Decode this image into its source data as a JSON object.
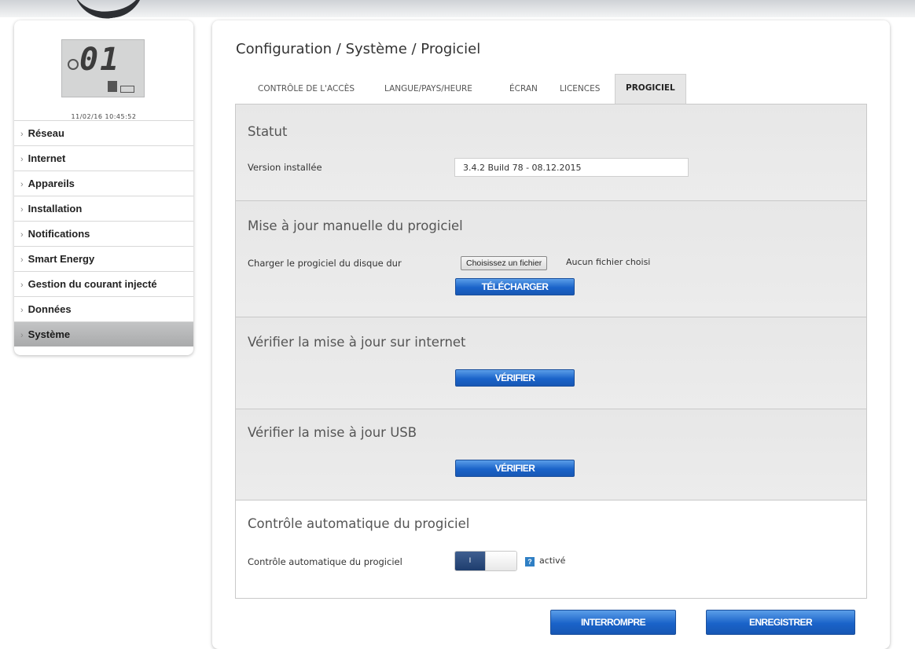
{
  "display": {
    "lcd_digits": "01",
    "datetime": "11/02/16 10:45:52"
  },
  "sidebar": {
    "items": [
      {
        "label": "Réseau"
      },
      {
        "label": "Internet"
      },
      {
        "label": "Appareils"
      },
      {
        "label": "Installation"
      },
      {
        "label": "Notifications"
      },
      {
        "label": "Smart Energy"
      },
      {
        "label": "Gestion du courant injecté"
      },
      {
        "label": "Données"
      },
      {
        "label": "Système",
        "active": true
      }
    ]
  },
  "header": {
    "breadcrumb": "Configuration / Système / Progiciel"
  },
  "tabs": [
    {
      "label": "CONTRÔLE DE L'ACCÈS"
    },
    {
      "label": "LANGUE/PAYS/HEURE"
    },
    {
      "label": "ÉCRAN"
    },
    {
      "label": "LICENCES"
    },
    {
      "label": "PROGICIEL",
      "active": true
    }
  ],
  "status": {
    "title": "Statut",
    "version_label": "Version installée",
    "version_value": "3.4.2 Build 78 - 08.12.2015"
  },
  "manual_update": {
    "title": "Mise à jour manuelle du progiciel",
    "load_label": "Charger le progiciel du disque dur",
    "file_button": "Choisissez un fichier",
    "file_status": "Aucun fichier choisi",
    "upload_button": "TÉLÉCHARGER"
  },
  "internet_check": {
    "title": "Vérifier la mise à jour sur internet",
    "button": "VÉRIFIER"
  },
  "usb_check": {
    "title": "Vérifier la mise à jour USB",
    "button": "VÉRIFIER"
  },
  "auto_check": {
    "title": "Contrôle automatique du progiciel",
    "label": "Contrôle automatique du progiciel",
    "toggle_on_text": "I",
    "help": "?",
    "state": "activé"
  },
  "footer": {
    "cancel": "INTERROMPRE",
    "save": "ENREGISTRER"
  },
  "colors": {
    "button_blue": "#1a63c9",
    "toggle_navy": "#1e3d6e",
    "active_nav": "#b5b6b7",
    "section_grey": "#e9e9e9"
  }
}
